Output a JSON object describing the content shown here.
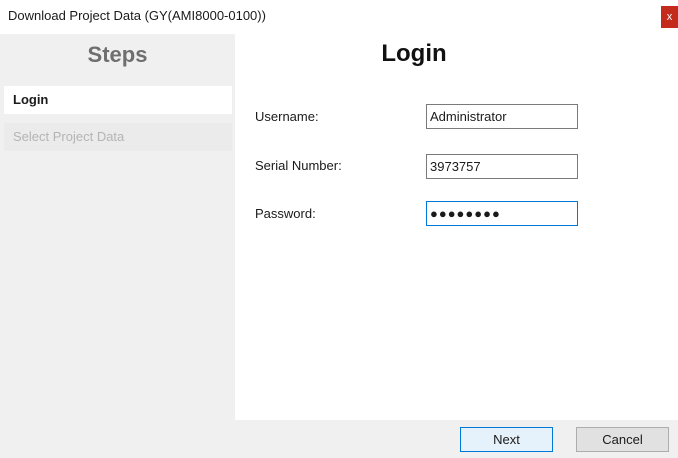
{
  "window": {
    "title": "Download Project Data (GY(AMI8000-0100))",
    "close_glyph": "x"
  },
  "sidebar": {
    "title": "Steps",
    "items": [
      {
        "label": "Login",
        "state": "active"
      },
      {
        "label": "Select Project Data",
        "state": "disabled"
      }
    ]
  },
  "main": {
    "title": "Login",
    "fields": {
      "username": {
        "label": "Username:",
        "value": "Administrator"
      },
      "serial": {
        "label": "Serial Number:",
        "value": "3973757"
      },
      "password": {
        "label": "Password:",
        "value": "●●●●●●●●"
      }
    }
  },
  "footer": {
    "next_label": "Next",
    "cancel_label": "Cancel"
  },
  "colors": {
    "accent": "#0078d7",
    "close": "#c42b1c",
    "sidebar_bg": "#f0f0f0"
  }
}
